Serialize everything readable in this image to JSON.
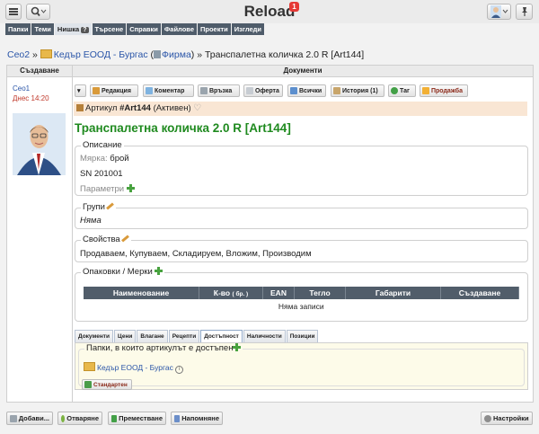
{
  "app": {
    "title": "Reload",
    "badge": "1"
  },
  "nav": [
    "Папки",
    "Теми",
    "Нишка",
    "Търсене",
    "Справки",
    "Файлове",
    "Проекти",
    "Изгледи"
  ],
  "nav_active_badge": "?",
  "breadcrumb": {
    "root": "Сео2",
    "sep": "»",
    "company": "Кедър ЕООД - Бургас",
    "firm": "Фирма",
    "current": "Транспалетна количка 2.0 R [Art144]"
  },
  "columns": {
    "left": "Създаване",
    "right": "Документи"
  },
  "creator": {
    "name": "Сео1",
    "time": "Днес 14:20"
  },
  "toolbar": [
    "Редакция",
    "Коментар",
    "Връзка",
    "Оферта",
    "Всички",
    "История (1)",
    "Таг",
    "Продажба"
  ],
  "article": {
    "prefix": "Артикул",
    "code": "#Art144",
    "status": "(Активен)",
    "title": "Транспалетна количка 2.0 R [Art144]"
  },
  "description": {
    "legend": "Описание",
    "unit_label": "Мярка:",
    "unit": "брой",
    "serial": "SN 201001",
    "params": "Параметри"
  },
  "groups": {
    "legend": "Групи",
    "value": "Няма"
  },
  "properties": {
    "legend": "Свойства",
    "value": "Продаваем, Купуваем, Складируем, Вложим, Производим"
  },
  "packaging": {
    "legend": "Опаковки / Мерки",
    "headers": [
      "Наименование",
      "К-во",
      "EAN",
      "Тегло",
      "Габарити",
      "Създаване"
    ],
    "qty_unit": "( бр. )",
    "empty": "Няма записи"
  },
  "tabs": [
    "Документи",
    "Цени",
    "Влагане",
    "Рецепти",
    "Достъпност",
    "Наличности",
    "Позиции"
  ],
  "active_tab": 4,
  "access": {
    "legend": "Папки, в които артикулът е достъпен",
    "folder": "Кедър ЕООД - Бургас",
    "standard_btn": "Стандартен"
  },
  "bottom": {
    "add": "Добави...",
    "open": "Отваряне",
    "move": "Преместване",
    "remind": "Напомняне",
    "settings": "Настройки"
  },
  "colors": {
    "accent_green": "#1f8a1f",
    "link_blue": "#2a55a8",
    "nav_dark": "#4f5c6a",
    "time_red": "#c0392b"
  }
}
